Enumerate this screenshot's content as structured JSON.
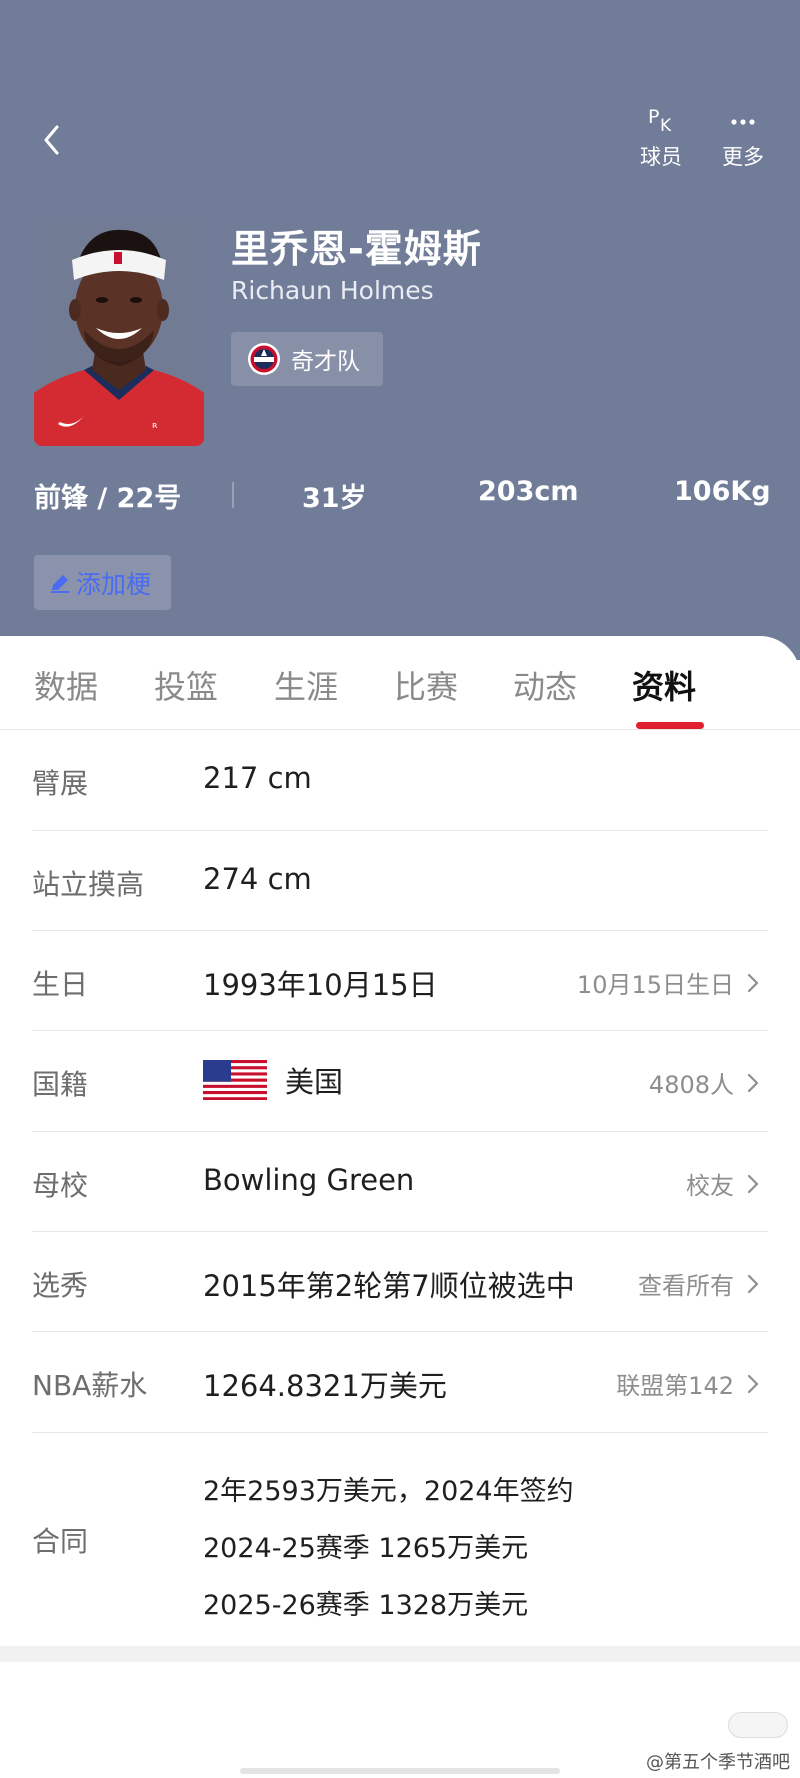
{
  "header": {
    "pk_label": "球员",
    "more_label": "更多",
    "pk_letters": {
      "p": "P",
      "k": "K"
    },
    "name_cn": "里乔恩-霍姆斯",
    "name_en": "Richaun Holmes",
    "team": "奇才队",
    "position_number": "前锋 / 22号",
    "age": "31岁",
    "height": "203cm",
    "weight": "106Kg",
    "add_meme": "添加梗",
    "bg_color": "#717c98"
  },
  "tabs": [
    {
      "label": "数据"
    },
    {
      "label": "投篮"
    },
    {
      "label": "生涯"
    },
    {
      "label": "比赛"
    },
    {
      "label": "动态"
    },
    {
      "label": "资料",
      "active": true
    }
  ],
  "profile": {
    "wingspan": {
      "label": "臂展",
      "value": "217 cm"
    },
    "standing_reach": {
      "label": "站立摸高",
      "value": "274 cm"
    },
    "birthday": {
      "label": "生日",
      "value": "1993年10月15日",
      "right": "10月15日生日"
    },
    "nationality": {
      "label": "国籍",
      "value": "美国",
      "right": "4808人"
    },
    "college": {
      "label": "母校",
      "value": "Bowling Green",
      "right": "校友"
    },
    "draft": {
      "label": "选秀",
      "value": "2015年第2轮第7顺位被选中",
      "right": "查看所有"
    },
    "salary": {
      "label": "NBA薪水",
      "value": "1264.8321万美元",
      "right": "联盟第142"
    },
    "contract": {
      "label": "合同",
      "lines": [
        "2年2593万美元，2024年签约",
        "2024-25赛季 1265万美元",
        "2025-26赛季 1328万美元"
      ]
    }
  },
  "watermark": "@第五个季节酒吧",
  "accent_color": "#e0202e"
}
